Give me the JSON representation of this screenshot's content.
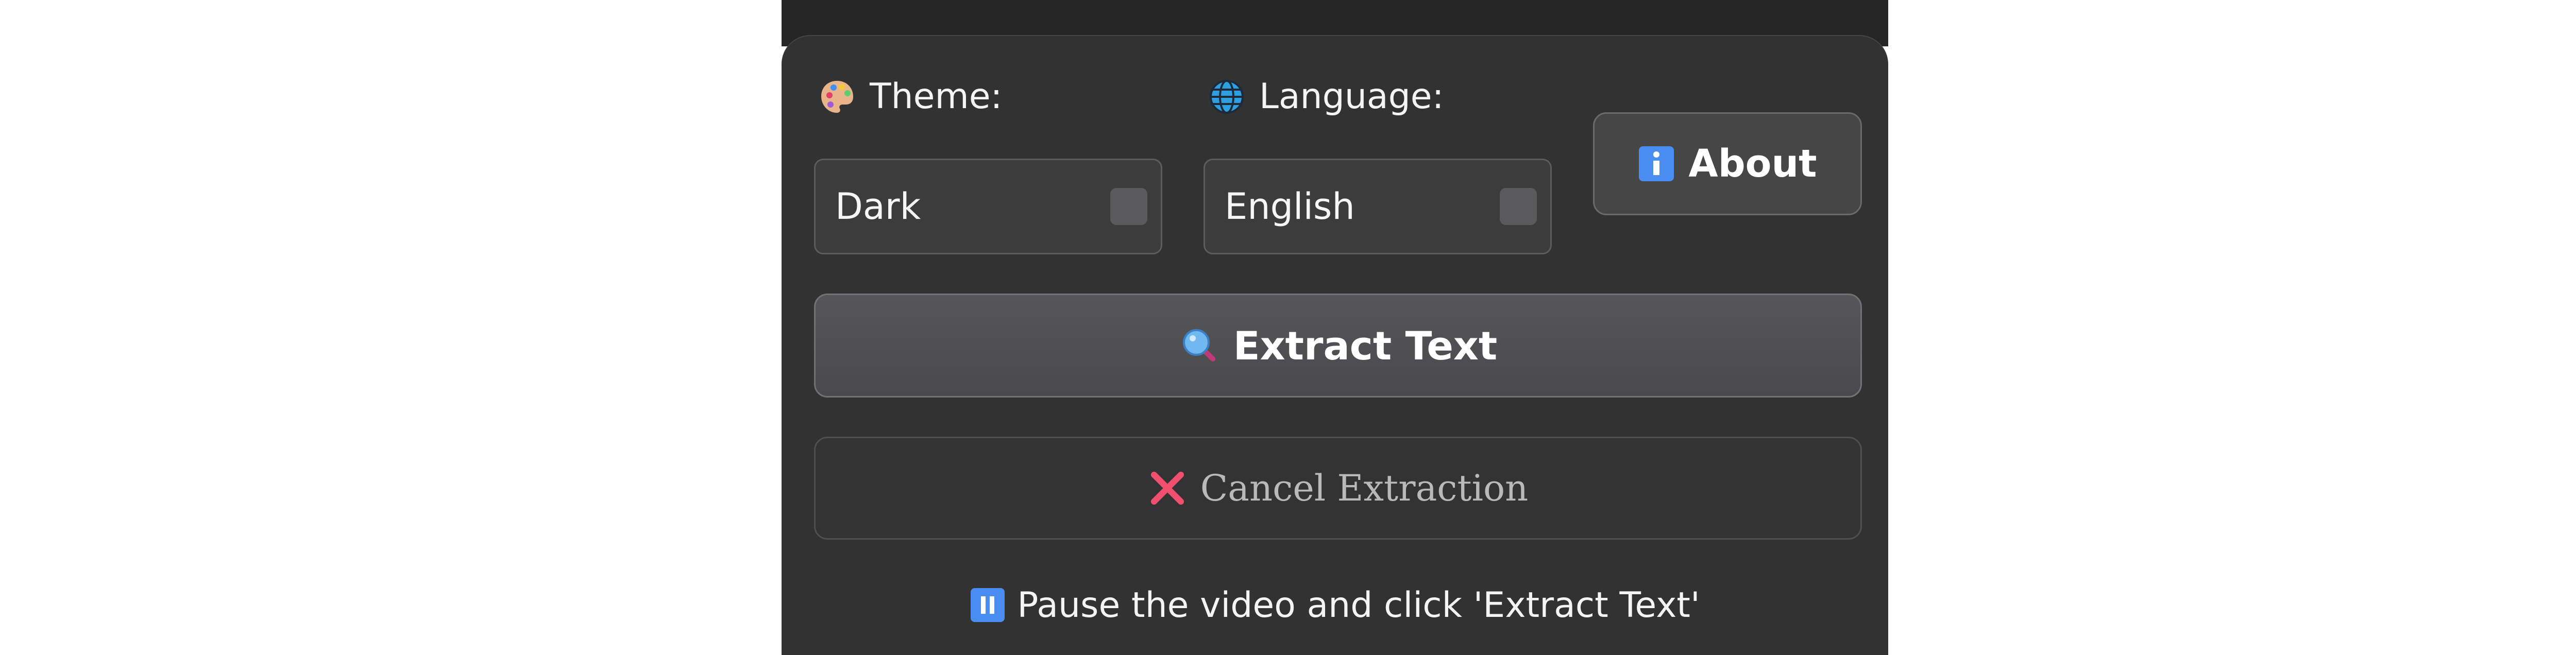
{
  "theme": {
    "label": "Theme:",
    "icon": "palette-icon",
    "selected": "Dark"
  },
  "language": {
    "label": "Language:",
    "icon": "globe-icon",
    "selected": "English"
  },
  "about_button": {
    "label": "About",
    "icon": "info-icon"
  },
  "extract_button": {
    "label": "Extract Text",
    "icon": "magnifier-icon"
  },
  "cancel_button": {
    "label": "Cancel Extraction",
    "icon": "cross-icon"
  },
  "status": {
    "text": "Pause the video and click 'Extract Text'",
    "icon": "pause-icon"
  },
  "colors": {
    "panel": "#323233",
    "button": "#4a4a4c",
    "cancel_icon": "#f0506e",
    "info_badge": "#4a8df0"
  }
}
